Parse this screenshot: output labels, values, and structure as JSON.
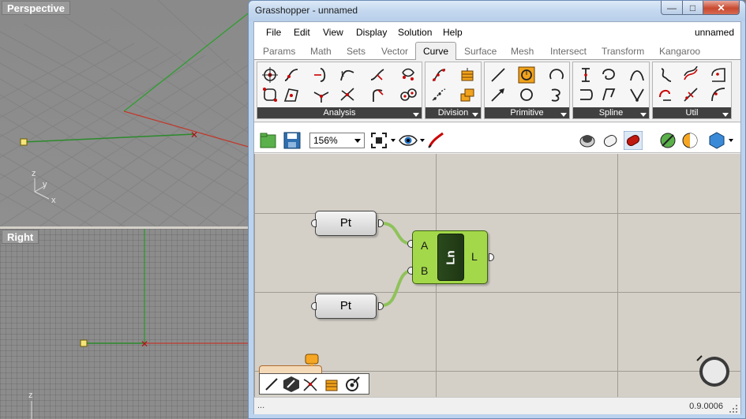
{
  "rhino": {
    "perspective_label": "Perspective",
    "right_label": "Right",
    "axis_z": "z",
    "axis_y": "y",
    "axis_x": "x"
  },
  "window": {
    "title": "Grasshopper - unnamed",
    "min_symbol": "—",
    "max_symbol": "□",
    "close_symbol": "✕"
  },
  "menu": {
    "items": [
      "File",
      "Edit",
      "View",
      "Display",
      "Solution",
      "Help"
    ],
    "document_name": "unnamed"
  },
  "tabs": {
    "items": [
      "Params",
      "Math",
      "Sets",
      "Vector",
      "Curve",
      "Surface",
      "Mesh",
      "Intersect",
      "Transform",
      "Kangaroo"
    ],
    "active": "Curve"
  },
  "ribbon": {
    "groups": [
      "Analysis",
      "Division",
      "Primitive",
      "Spline",
      "Util"
    ]
  },
  "toolbar": {
    "zoom": "156%"
  },
  "canvas": {
    "pt_top_label": "Pt",
    "pt_bottom_label": "Pt",
    "component_nickname": "Ln",
    "input_a": "A",
    "input_b": "B",
    "output_l": "L"
  },
  "status": {
    "left": "...",
    "version": "0.9.0006"
  },
  "colors": {
    "component_green": "#a3d84a",
    "wire_green": "#8fc25a",
    "axis_red": "#c0392b",
    "axis_green": "#2e9e2e",
    "close_red": "#c8492f"
  }
}
